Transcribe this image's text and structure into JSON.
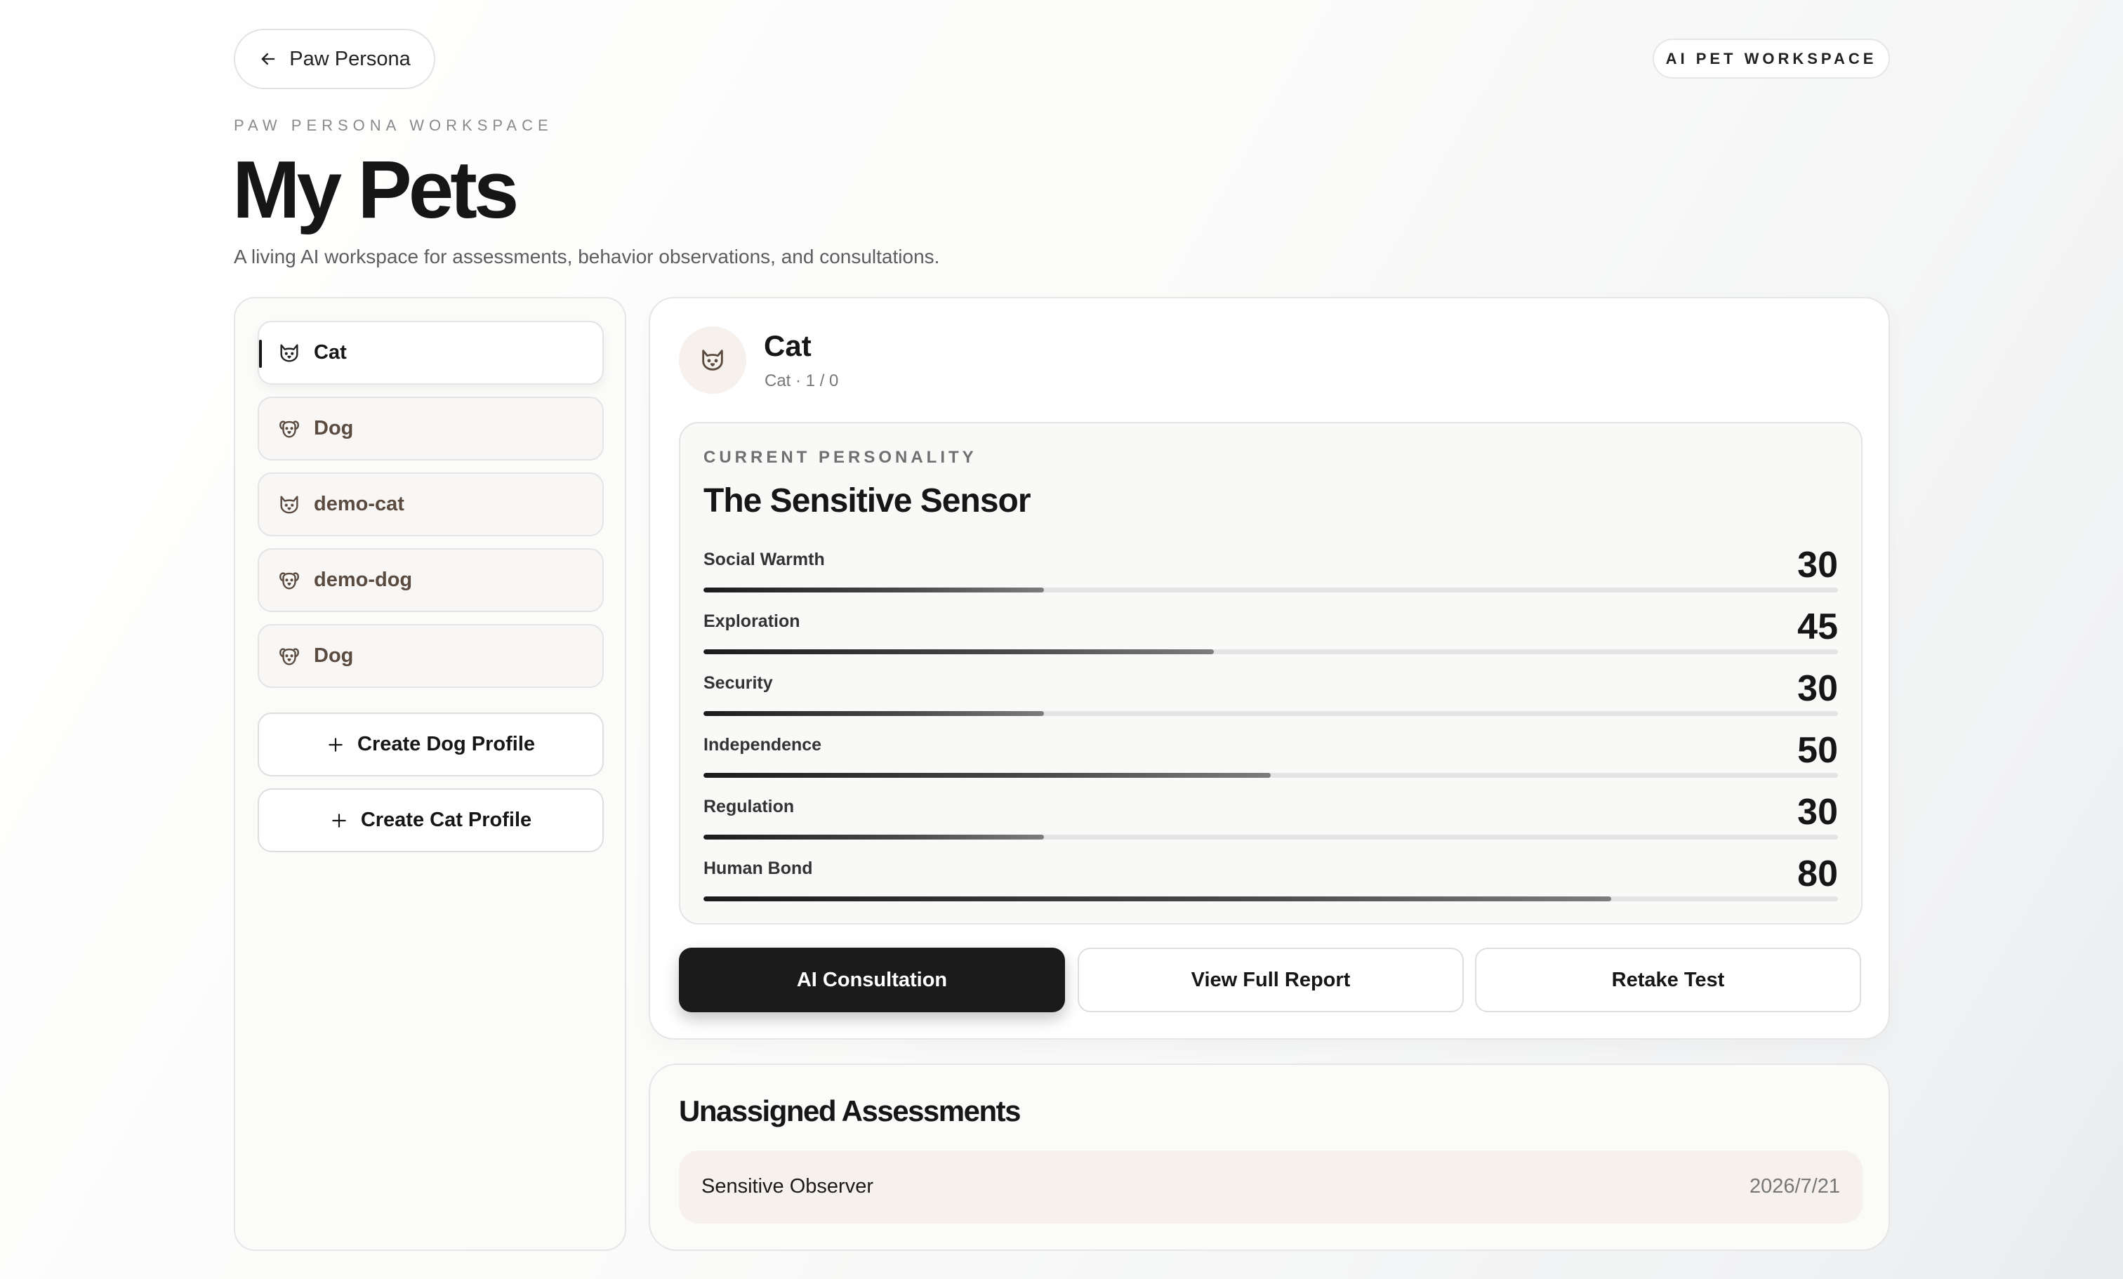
{
  "header": {
    "back_label": "Paw Persona",
    "workspace_badge": "AI PET WORKSPACE",
    "eyebrow": "PAW PERSONA WORKSPACE",
    "title": "My Pets",
    "subtitle": "A living AI workspace for assessments, behavior observations, and consultations."
  },
  "sidebar": {
    "pets": [
      {
        "name": "Cat",
        "species": "cat",
        "icon": "cat-icon",
        "active": true
      },
      {
        "name": "Dog",
        "species": "dog",
        "icon": "dog-icon",
        "active": false
      },
      {
        "name": "demo-cat",
        "species": "cat",
        "icon": "cat-icon",
        "active": false
      },
      {
        "name": "demo-dog",
        "species": "dog",
        "icon": "dog-icon",
        "active": false
      },
      {
        "name": "Dog",
        "species": "dog",
        "icon": "dog-icon",
        "active": false
      }
    ],
    "create_dog_label": "Create Dog Profile",
    "create_cat_label": "Create Cat Profile"
  },
  "pet_card": {
    "name": "Cat",
    "meta": "Cat · 1 / 0",
    "personality_label": "CURRENT PERSONALITY",
    "personality_title": "The Sensitive Sensor",
    "traits": [
      {
        "label": "Social Warmth",
        "value": "30",
        "percent": 30
      },
      {
        "label": "Exploration",
        "value": "45",
        "percent": 45
      },
      {
        "label": "Security",
        "value": "30",
        "percent": 30
      },
      {
        "label": "Independence",
        "value": "50",
        "percent": 50
      },
      {
        "label": "Regulation",
        "value": "30",
        "percent": 30
      },
      {
        "label": "Human Bond",
        "value": "80",
        "percent": 80
      }
    ],
    "actions": {
      "consult": "AI Consultation",
      "report": "View Full Report",
      "retake": "Retake Test"
    }
  },
  "unassigned": {
    "title": "Unassigned Assessments",
    "items": [
      {
        "name": "Sensitive Observer",
        "date": "2026/7/21"
      }
    ]
  },
  "colors": {
    "primary_button": "#1b1b1b",
    "accent_warm": "#f6f1ec",
    "bar_track": "#e4e4e4"
  }
}
